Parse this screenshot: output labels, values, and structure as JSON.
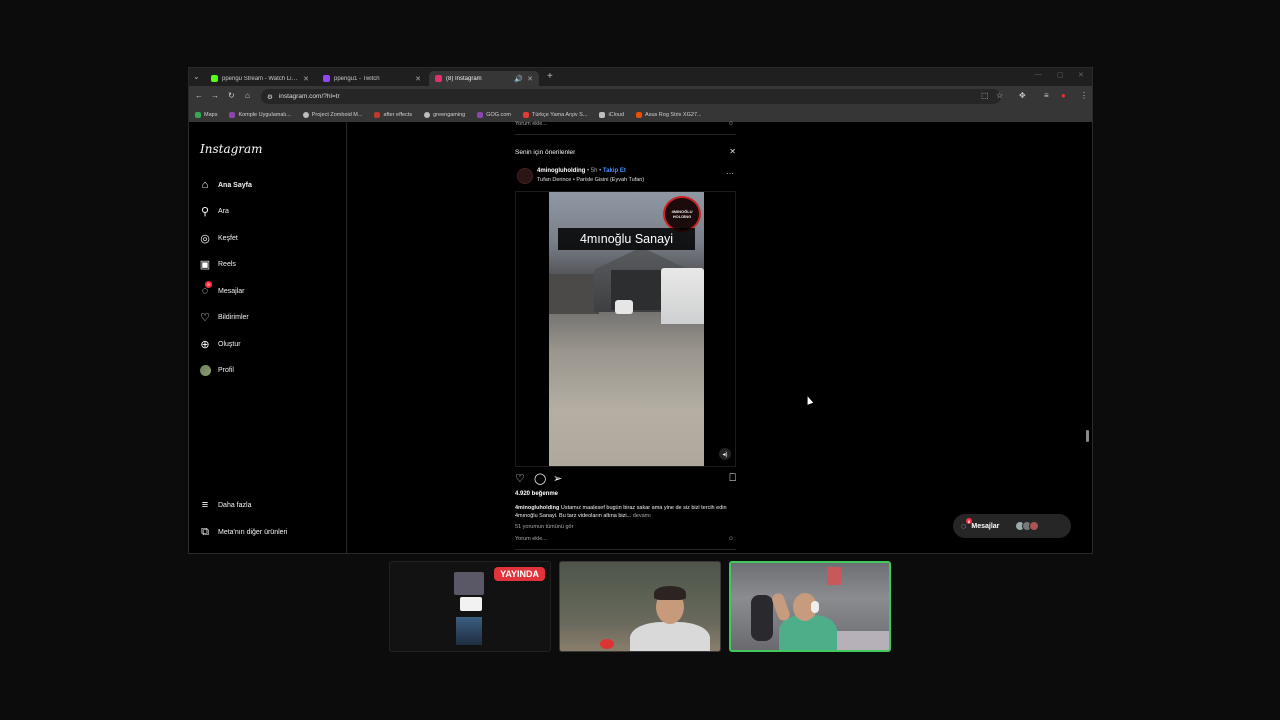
{
  "browser": {
    "tabs": [
      {
        "title": "ppengu Stream - Watch Live o",
        "favicon_color": "#53fc18",
        "active": false
      },
      {
        "title": "ppengu1 - Twitch",
        "favicon_color": "#9146ff",
        "active": false
      },
      {
        "title": "(8) Instagram",
        "favicon_color": "#e1306c",
        "active": true
      }
    ],
    "url": "instagram.com/?hl=tr",
    "bookmarks": [
      {
        "label": "Maps",
        "color": "#34a853"
      },
      {
        "label": "Komple Uygulamalı...",
        "color": "#8e44ad"
      },
      {
        "label": "Project Zomboid M...",
        "color": "#bdbdbd"
      },
      {
        "label": "after effects",
        "color": "#c0392b"
      },
      {
        "label": "greengaming",
        "color": "#bdbdbd"
      },
      {
        "label": "GOG.com",
        "color": "#8e44ad"
      },
      {
        "label": "Türkçe Yama Arşiv S...",
        "color": "#e53935"
      },
      {
        "label": "iCloud",
        "color": "#bdbdbd"
      },
      {
        "label": "Asus Rog Strix XG27...",
        "color": "#e65100"
      }
    ]
  },
  "sidebar": {
    "logo": "Instagram",
    "items": [
      {
        "label": "Ana Sayfa",
        "icon": "home-icon"
      },
      {
        "label": "Ara",
        "icon": "search-icon"
      },
      {
        "label": "Keşfet",
        "icon": "compass-icon"
      },
      {
        "label": "Reels",
        "icon": "reels-icon"
      },
      {
        "label": "Mesajlar",
        "icon": "messenger-icon",
        "badge": "8"
      },
      {
        "label": "Bildirimler",
        "icon": "heart-icon"
      },
      {
        "label": "Oluştur",
        "icon": "plus-square-icon"
      },
      {
        "label": "Profil",
        "icon": "avatar"
      }
    ],
    "more": "Daha fazla",
    "meta": "Meta'nın diğer ürünleri"
  },
  "feed": {
    "prev_comment_placeholder": "Yorum ekle...",
    "suggestions_title": "Senin için önerilenler",
    "post": {
      "username": "4minogluholding",
      "time": "5h",
      "follow": "Takip Et",
      "audio": "Tufan Derince • Parisle Gisini (Eyvah Tufan)",
      "brand_badge": "4MINOĞLU HOLDİNG",
      "overlay_title": "4mınoğlu Sanayi",
      "likes": "4.920 beğenme",
      "caption_user": "4minogluholding",
      "caption_text": "Ustamız maalesef bugün biraz sakar ama yine de siz bizi tercih edin 4mınoğlu Sanayi. Bu tarz videoların altına bizi...",
      "caption_more": "devamı",
      "comments_link": "51 yorumun tümünü gör",
      "comment_placeholder": "Yorum ekle..."
    }
  },
  "messages_pill": {
    "label": "Mesajlar",
    "badge": "8"
  },
  "overlay": {
    "live_badge": "YAYINDA"
  }
}
